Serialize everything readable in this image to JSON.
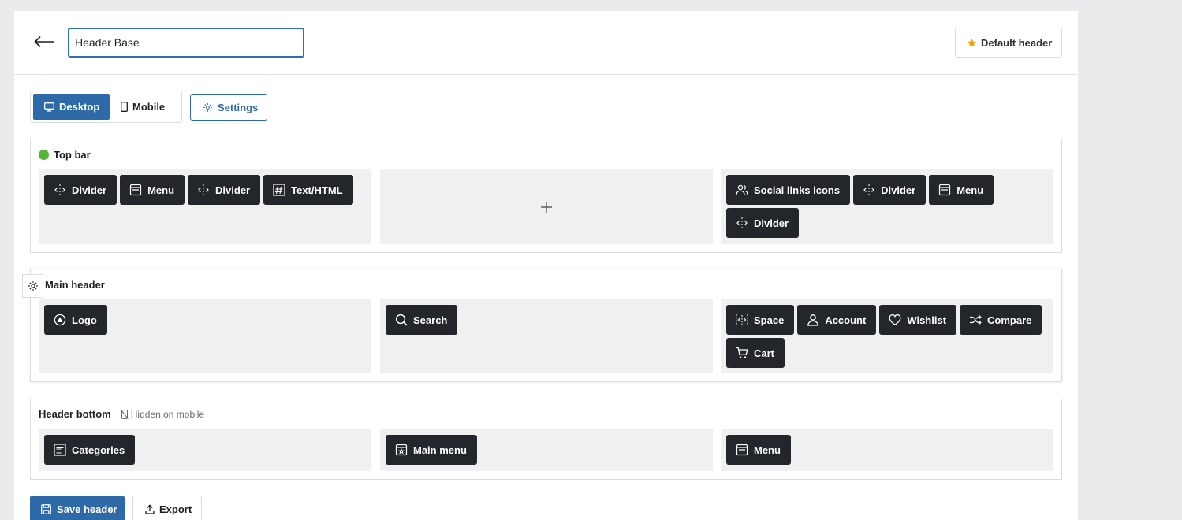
{
  "header": {
    "name_value": "Header Base",
    "default_label": "Default header"
  },
  "device_tabs": [
    {
      "label": "Desktop",
      "icon": "desktop-icon",
      "active": true
    },
    {
      "label": "Mobile",
      "icon": "mobile-icon",
      "active": false
    }
  ],
  "settings_label": "Settings",
  "rows": {
    "top_bar": {
      "title": "Top bar",
      "status_color": "#58b237",
      "left": [
        {
          "label": "Divider",
          "icon": "divider-icon"
        },
        {
          "label": "Menu",
          "icon": "menu-icon"
        },
        {
          "label": "Divider",
          "icon": "divider-icon"
        },
        {
          "label": "Text/HTML",
          "icon": "hash-icon"
        }
      ],
      "center": [],
      "right": [
        {
          "label": "Social links icons",
          "icon": "users-icon"
        },
        {
          "label": "Divider",
          "icon": "divider-icon"
        },
        {
          "label": "Menu",
          "icon": "menu-icon"
        },
        {
          "label": "Divider",
          "icon": "divider-icon"
        }
      ]
    },
    "main_header": {
      "title": "Main header",
      "left": [
        {
          "label": "Logo",
          "icon": "logo-icon"
        }
      ],
      "center": [
        {
          "label": "Search",
          "icon": "search-icon"
        }
      ],
      "right": [
        {
          "label": "Space",
          "icon": "space-icon"
        },
        {
          "label": "Account",
          "icon": "account-icon"
        },
        {
          "label": "Wishlist",
          "icon": "heart-icon"
        },
        {
          "label": "Compare",
          "icon": "shuffle-icon"
        },
        {
          "label": "Cart",
          "icon": "cart-icon"
        }
      ]
    },
    "header_bottom": {
      "title": "Header bottom",
      "hidden_note": "Hidden on mobile",
      "left": [
        {
          "label": "Categories",
          "icon": "categories-icon"
        }
      ],
      "center": [
        {
          "label": "Main menu",
          "icon": "main-menu-icon"
        }
      ],
      "right": [
        {
          "label": "Menu",
          "icon": "menu-icon"
        }
      ]
    }
  },
  "actions": {
    "save_label": "Save header",
    "export_label": "Export"
  },
  "colors": {
    "accent": "#2f6aa8",
    "chip_bg": "#23272b",
    "zone_bg": "#f0f0f0",
    "star": "#f0a30a"
  }
}
